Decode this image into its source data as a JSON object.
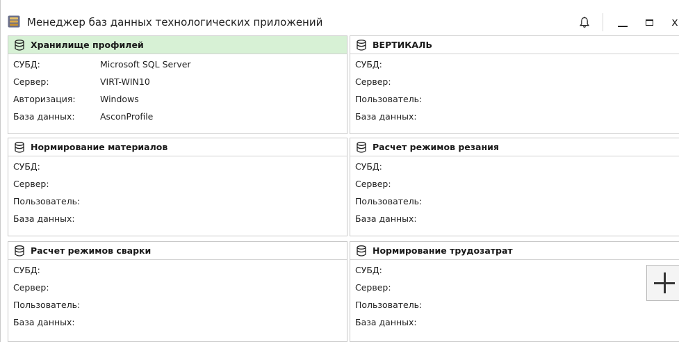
{
  "window": {
    "title": "Менеджер баз данных технологических приложений",
    "app_icon": "database-app-icon",
    "controls": [
      "bell-icon",
      "minimize-icon",
      "maximize-icon",
      "close-icon"
    ],
    "close_glyph": "x"
  },
  "colors": {
    "active_header": "#d7f1d5",
    "border": "#c8c8c8"
  },
  "panels": [
    {
      "title": "Хранилище профилей",
      "active": true,
      "rows": [
        {
          "label": "СУБД:",
          "value": "Microsoft SQL Server"
        },
        {
          "label": "Сервер:",
          "value": "VIRT-WIN10"
        },
        {
          "label": "Авторизация:",
          "value": "Windows"
        },
        {
          "label": "База данных:",
          "value": "AsconProfile"
        }
      ]
    },
    {
      "title": "ВЕРТИКАЛЬ",
      "active": false,
      "rows": [
        {
          "label": "СУБД:",
          "value": ""
        },
        {
          "label": "Сервер:",
          "value": ""
        },
        {
          "label": "Пользователь:",
          "value": ""
        },
        {
          "label": "База данных:",
          "value": ""
        }
      ]
    },
    {
      "title": "Нормирование материалов",
      "active": false,
      "rows": [
        {
          "label": "СУБД:",
          "value": ""
        },
        {
          "label": "Сервер:",
          "value": ""
        },
        {
          "label": "Пользователь:",
          "value": ""
        },
        {
          "label": "База данных:",
          "value": ""
        }
      ]
    },
    {
      "title": "Расчет режимов резания",
      "active": false,
      "rows": [
        {
          "label": "СУБД:",
          "value": ""
        },
        {
          "label": "Сервер:",
          "value": ""
        },
        {
          "label": "Пользователь:",
          "value": ""
        },
        {
          "label": "База данных:",
          "value": ""
        }
      ]
    },
    {
      "title": "Расчет режимов сварки",
      "active": false,
      "rows": [
        {
          "label": "СУБД:",
          "value": ""
        },
        {
          "label": "Сервер:",
          "value": ""
        },
        {
          "label": "Пользователь:",
          "value": ""
        },
        {
          "label": "База данных:",
          "value": ""
        }
      ]
    },
    {
      "title": "Нормирование трудозатрат",
      "active": false,
      "rows": [
        {
          "label": "СУБД:",
          "value": ""
        },
        {
          "label": "Сервер:",
          "value": ""
        },
        {
          "label": "Пользователь:",
          "value": ""
        },
        {
          "label": "База данных:",
          "value": ""
        }
      ]
    }
  ],
  "add_button": {
    "icon": "plus-icon"
  }
}
